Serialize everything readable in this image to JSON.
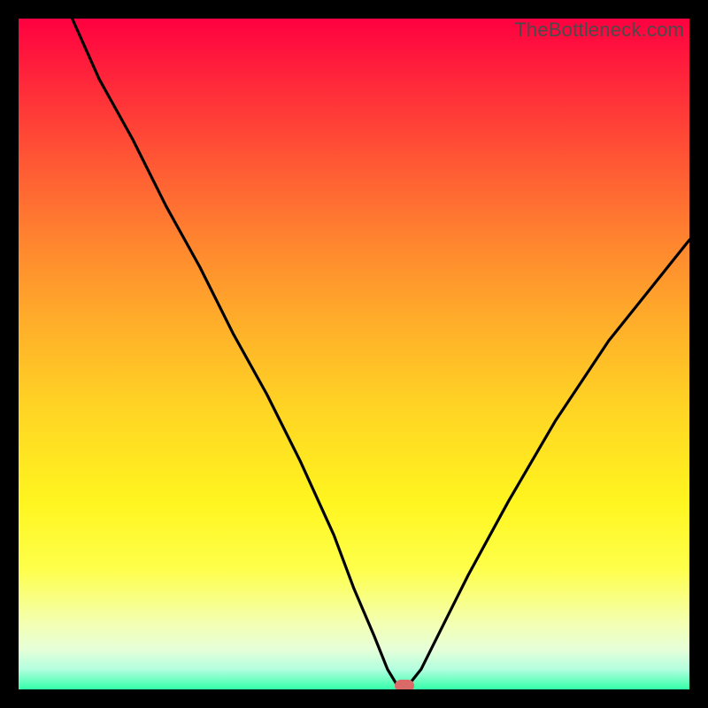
{
  "watermark": "TheBottleneck.com",
  "colors": {
    "curve": "#000000",
    "marker": "#d96a68",
    "frame": "#000000"
  },
  "chart_data": {
    "type": "line",
    "title": "",
    "xlabel": "",
    "ylabel": "",
    "xlim": [
      0,
      100
    ],
    "ylim": [
      0,
      100
    ],
    "grid": false,
    "legend": false,
    "note": "V-shaped bottleneck curve; axes have no visible tick labels. Values are estimated from pixel positions: y = 100 at top, y = 0 at bottom green band.",
    "series": [
      {
        "name": "bottleneck-curve",
        "x": [
          8,
          12,
          17,
          22,
          27,
          32,
          37,
          42,
          47,
          50,
          53,
          55,
          56.5,
          58,
          60,
          63,
          67,
          73,
          80,
          88,
          96,
          100
        ],
        "y": [
          100,
          91,
          82,
          72,
          63,
          53,
          44,
          34,
          23,
          15,
          8,
          3,
          0.5,
          0.5,
          3,
          9,
          17,
          28,
          40,
          52,
          62,
          67
        ]
      }
    ],
    "marker": {
      "x": 57.5,
      "y": 0.5
    }
  }
}
